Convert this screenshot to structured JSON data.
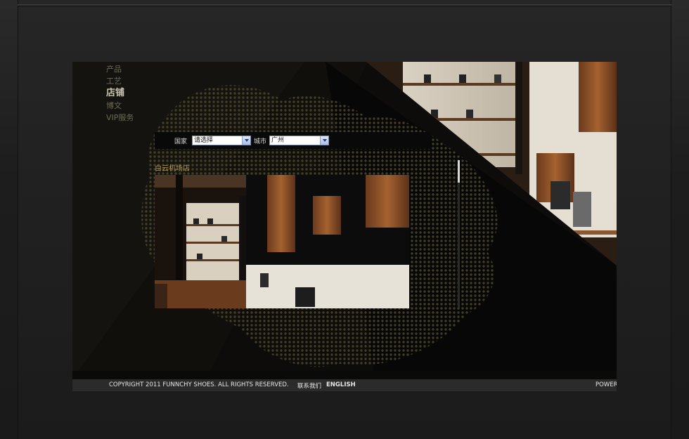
{
  "nav": {
    "items": [
      {
        "label": "产品",
        "active": false
      },
      {
        "label": "工艺",
        "active": false
      },
      {
        "label": "店铺",
        "active": true
      },
      {
        "label": "博文",
        "active": false
      },
      {
        "label": "VIP服务",
        "active": false
      }
    ]
  },
  "filter": {
    "country_label": "国家",
    "country_value": "请选择",
    "city_label": "城市",
    "city_value": "广州"
  },
  "store": {
    "name": "白云机场店"
  },
  "footer": {
    "copyright": "COPYRIGHT 2011 FUNNCHY SHOES. ALL RIGHTS RESERVED.",
    "contact_link": "联系我们",
    "english_link": "ENGLISH",
    "powered": "POWER"
  },
  "colors": {
    "nav_active": "#c9c4ae",
    "nav_inactive": "#6c6858",
    "store_name": "#b09a52",
    "halftone": "#5a5230"
  }
}
